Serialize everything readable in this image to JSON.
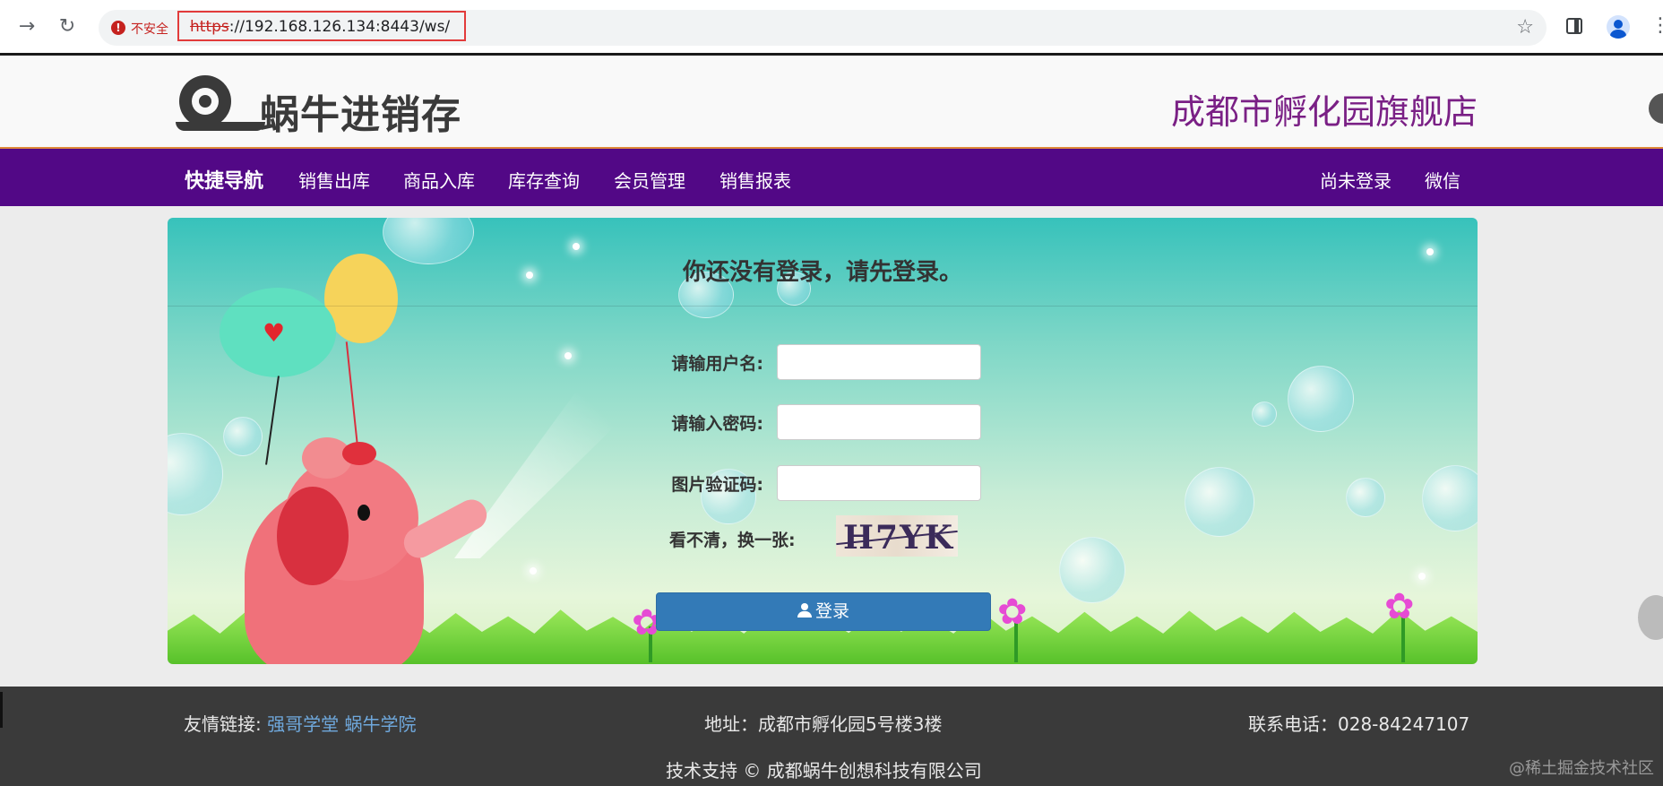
{
  "browser": {
    "security_label": "不安全",
    "url_scheme": "https",
    "url_rest": "://192.168.126.134:8443/ws/"
  },
  "header": {
    "logo_text": "蜗牛进销存",
    "store_name": "成都市孵化园旗舰店"
  },
  "nav": {
    "brand": "快捷导航",
    "items": [
      "销售出库",
      "商品入库",
      "库存查询",
      "会员管理",
      "销售报表"
    ],
    "login_status": "尚未登录",
    "wechat": "微信"
  },
  "login": {
    "title": "你还没有登录，请先登录。",
    "username_label": "请输用户名:",
    "password_label": "请输入密码:",
    "captcha_label": "图片验证码:",
    "captcha_hint": "看不清，换一张:",
    "captcha_text": "H7YK",
    "submit_label": "登录",
    "username_value": "",
    "password_value": "",
    "captcha_value": ""
  },
  "footer": {
    "links_label": "友情链接:",
    "links": [
      "强哥学堂",
      "蜗牛学院"
    ],
    "address": "地址：成都市孵化园5号楼3楼",
    "phone": "联系电话：028-84247107",
    "support": "技术支持 © 成都蜗牛创想科技有限公司",
    "watermark": "@稀土掘金技术社区"
  },
  "colors": {
    "nav_purple": "#520886",
    "store_name": "#7a2085",
    "button_blue": "#337ab7",
    "footer_bg": "#3a3a3a"
  }
}
